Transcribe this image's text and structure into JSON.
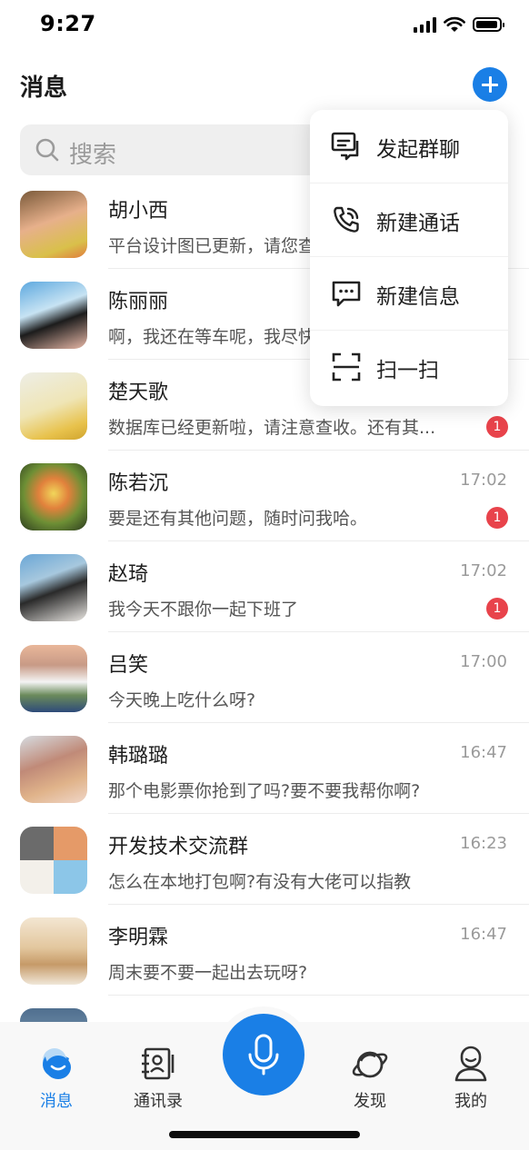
{
  "status_bar": {
    "time": "9:27"
  },
  "header": {
    "title": "消息"
  },
  "search": {
    "placeholder": "搜索"
  },
  "chats": [
    {
      "name": "胡小西",
      "preview": "平台设计图已更新，请您查收一下",
      "time": "",
      "badge": "",
      "avatar_color": "#d98a6a"
    },
    {
      "name": "陈丽丽",
      "preview": "啊，我还在等车呢，我尽快到",
      "time": "",
      "badge": "",
      "avatar_color": "#7ab3e0"
    },
    {
      "name": "楚天歌",
      "preview": "数据库已经更新啦，请注意查收。还有其...",
      "time": "",
      "badge": "1",
      "avatar_color": "#e8d27a"
    },
    {
      "name": "陈若沉",
      "preview": "要是还有其他问题，随时问我哈。",
      "time": "17:02",
      "badge": "1",
      "avatar_color": "#6f8f3a"
    },
    {
      "name": "赵琦",
      "preview": "我今天不跟你一起下班了",
      "time": "17:02",
      "badge": "1",
      "avatar_color": "#4d7fb0"
    },
    {
      "name": "吕笑",
      "preview": "今天晚上吃什么呀?",
      "time": "17:00",
      "badge": "",
      "avatar_color": "#9ab0b8"
    },
    {
      "name": "韩璐璐",
      "preview": "那个电影票你抢到了吗?要不要我帮你啊?",
      "time": "16:47",
      "badge": "",
      "avatar_color": "#c9846e"
    },
    {
      "name": "开发技术交流群",
      "preview": "怎么在本地打包啊?有没有大佬可以指教",
      "time": "16:23",
      "badge": "",
      "avatar_color": "#e59a68"
    },
    {
      "name": "李明霖",
      "preview": "周末要不要一起出去玩呀?",
      "time": "16:47",
      "badge": "",
      "avatar_color": "#d8b88a"
    }
  ],
  "popup_menu": {
    "items": [
      {
        "label": "发起群聊",
        "icon": "group-chat-icon"
      },
      {
        "label": "新建通话",
        "icon": "phone-call-icon"
      },
      {
        "label": "新建信息",
        "icon": "new-message-icon"
      },
      {
        "label": "扫一扫",
        "icon": "scan-icon"
      }
    ]
  },
  "bottom_nav": {
    "items": [
      {
        "label": "消息",
        "icon": "message-icon",
        "active": true
      },
      {
        "label": "通讯录",
        "icon": "contacts-icon",
        "active": false
      },
      {
        "label": "发现",
        "icon": "discover-icon",
        "active": false
      },
      {
        "label": "我的",
        "icon": "profile-icon",
        "active": false
      }
    ],
    "mic_icon": "microphone-icon"
  },
  "colors": {
    "accent": "#1a7fe6",
    "badge": "#e8434b"
  }
}
